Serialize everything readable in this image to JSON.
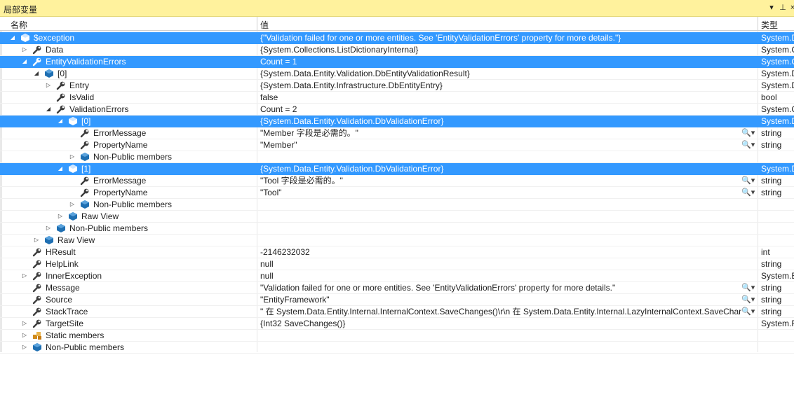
{
  "window": {
    "title": "局部变量",
    "dropdown_icon": "▾",
    "pin_icon": "⊥",
    "close_icon": "×"
  },
  "columns": {
    "name": "名称",
    "value": "值",
    "type": "类型"
  },
  "rows": [
    {
      "depth": 0,
      "expander": "expanded",
      "icon": "object",
      "name": "$exception",
      "value": "{\"Validation failed for one or more entities. See 'EntityValidationErrors' property for more details.\"}",
      "type": "System.D",
      "selected": true,
      "search": false
    },
    {
      "depth": 1,
      "expander": "collapsed",
      "icon": "property",
      "name": "Data",
      "value": "{System.Collections.ListDictionaryInternal}",
      "type": "System.C",
      "selected": false,
      "search": false
    },
    {
      "depth": 1,
      "expander": "expanded",
      "icon": "property",
      "name": "EntityValidationErrors",
      "value": "Count = 1",
      "type": "System.C",
      "selected": true,
      "search": false
    },
    {
      "depth": 2,
      "expander": "expanded",
      "icon": "object",
      "name": "[0]",
      "value": "{System.Data.Entity.Validation.DbEntityValidationResult}",
      "type": "System.D",
      "selected": false,
      "search": false
    },
    {
      "depth": 3,
      "expander": "collapsed",
      "icon": "property",
      "name": "Entry",
      "value": "{System.Data.Entity.Infrastructure.DbEntityEntry}",
      "type": "System.D",
      "selected": false,
      "search": false
    },
    {
      "depth": 3,
      "expander": "none",
      "icon": "property",
      "name": "IsValid",
      "value": "false",
      "type": "bool",
      "selected": false,
      "search": false
    },
    {
      "depth": 3,
      "expander": "expanded",
      "icon": "property",
      "name": "ValidationErrors",
      "value": "Count = 2",
      "type": "System.C",
      "selected": false,
      "search": false
    },
    {
      "depth": 4,
      "expander": "expanded",
      "icon": "object",
      "name": "[0]",
      "value": "{System.Data.Entity.Validation.DbValidationError}",
      "type": "System.D",
      "selected": true,
      "search": false
    },
    {
      "depth": 5,
      "expander": "none",
      "icon": "property",
      "name": "ErrorMessage",
      "value": "\"Member 字段是必需的。\"",
      "type": "string",
      "selected": false,
      "search": true
    },
    {
      "depth": 5,
      "expander": "none",
      "icon": "property",
      "name": "PropertyName",
      "value": "\"Member\"",
      "type": "string",
      "selected": false,
      "search": true
    },
    {
      "depth": 5,
      "expander": "collapsed",
      "icon": "object",
      "name": "Non-Public members",
      "value": "",
      "type": "",
      "selected": false,
      "search": false
    },
    {
      "depth": 4,
      "expander": "expanded",
      "icon": "object",
      "name": "[1]",
      "value": "{System.Data.Entity.Validation.DbValidationError}",
      "type": "System.D",
      "selected": true,
      "search": false
    },
    {
      "depth": 5,
      "expander": "none",
      "icon": "property",
      "name": "ErrorMessage",
      "value": "\"Tool 字段是必需的。\"",
      "type": "string",
      "selected": false,
      "search": true
    },
    {
      "depth": 5,
      "expander": "none",
      "icon": "property",
      "name": "PropertyName",
      "value": "\"Tool\"",
      "type": "string",
      "selected": false,
      "search": true
    },
    {
      "depth": 5,
      "expander": "collapsed",
      "icon": "object",
      "name": "Non-Public members",
      "value": "",
      "type": "",
      "selected": false,
      "search": false
    },
    {
      "depth": 4,
      "expander": "collapsed",
      "icon": "object",
      "name": "Raw View",
      "value": "",
      "type": "",
      "selected": false,
      "search": false
    },
    {
      "depth": 3,
      "expander": "collapsed",
      "icon": "object",
      "name": "Non-Public members",
      "value": "",
      "type": "",
      "selected": false,
      "search": false
    },
    {
      "depth": 2,
      "expander": "collapsed",
      "icon": "object",
      "name": "Raw View",
      "value": "",
      "type": "",
      "selected": false,
      "search": false
    },
    {
      "depth": 1,
      "expander": "none",
      "icon": "property",
      "name": "HResult",
      "value": "-2146232032",
      "type": "int",
      "selected": false,
      "search": false
    },
    {
      "depth": 1,
      "expander": "none",
      "icon": "property",
      "name": "HelpLink",
      "value": "null",
      "type": "string",
      "selected": false,
      "search": false
    },
    {
      "depth": 1,
      "expander": "collapsed",
      "icon": "property",
      "name": "InnerException",
      "value": "null",
      "type": "System.E",
      "selected": false,
      "search": false
    },
    {
      "depth": 1,
      "expander": "none",
      "icon": "property",
      "name": "Message",
      "value": "\"Validation failed for one or more entities. See 'EntityValidationErrors' property for more details.\"",
      "type": "string",
      "selected": false,
      "search": true
    },
    {
      "depth": 1,
      "expander": "none",
      "icon": "property",
      "name": "Source",
      "value": "\"EntityFramework\"",
      "type": "string",
      "selected": false,
      "search": true
    },
    {
      "depth": 1,
      "expander": "none",
      "icon": "property",
      "name": "StackTrace",
      "value": "\"   在 System.Data.Entity.Internal.InternalContext.SaveChanges()\\r\\n   在 System.Data.Entity.Internal.LazyInternalContext.SaveChar",
      "type": "string",
      "selected": false,
      "search": true
    },
    {
      "depth": 1,
      "expander": "collapsed",
      "icon": "property",
      "name": "TargetSite",
      "value": "{Int32 SaveChanges()}",
      "type": "System.F",
      "selected": false,
      "search": false
    },
    {
      "depth": 1,
      "expander": "collapsed",
      "icon": "static",
      "name": "Static members",
      "value": "",
      "type": "",
      "selected": false,
      "search": false
    },
    {
      "depth": 1,
      "expander": "collapsed",
      "icon": "object",
      "name": "Non-Public members",
      "value": "",
      "type": "",
      "selected": false,
      "search": false
    }
  ],
  "search_glyph": "🔍▾",
  "colors": {
    "title_bar": "#fff29d",
    "selection": "#3399ff",
    "object_icon": "#1f6fb2",
    "property_icon": "#3c3c3c",
    "static_icon": "#d08b1b"
  }
}
